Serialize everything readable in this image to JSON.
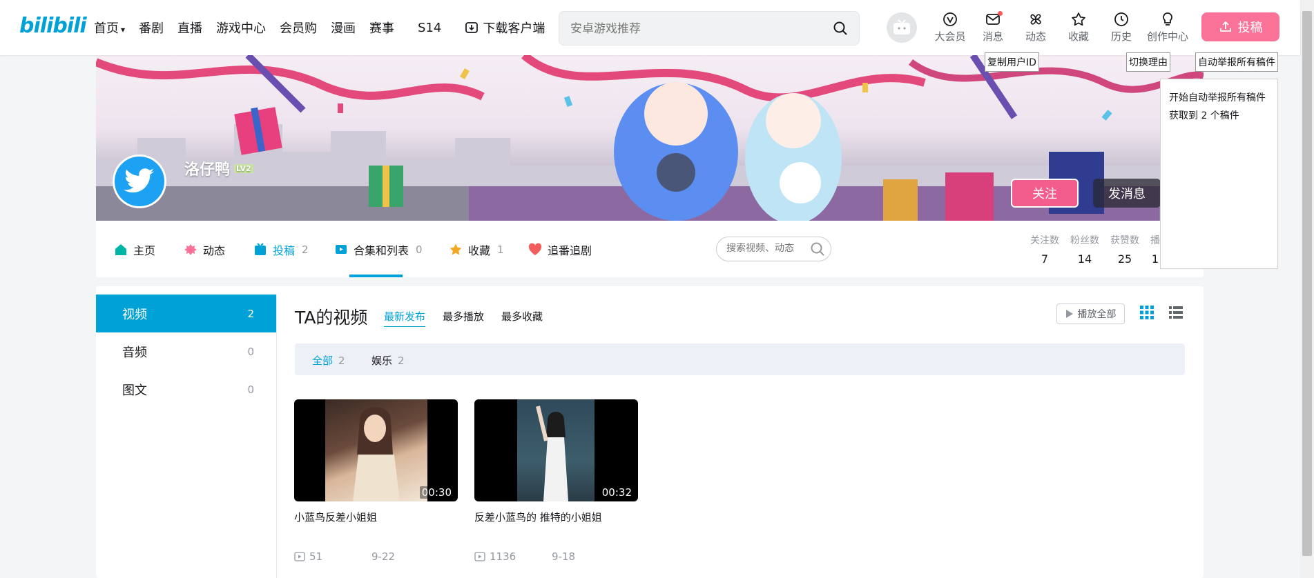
{
  "header": {
    "logo": "bilibili",
    "nav": [
      {
        "label": "首页",
        "has_chevron": true
      },
      {
        "label": "番剧"
      },
      {
        "label": "直播"
      },
      {
        "label": "游戏中心"
      },
      {
        "label": "会员购"
      },
      {
        "label": "漫画"
      },
      {
        "label": "赛事"
      },
      {
        "label": "S14"
      },
      {
        "label": "下载客户端",
        "icon": "download-icon"
      }
    ],
    "search_placeholder": "安卓游戏推荐",
    "tools": [
      {
        "label": "大会员",
        "icon": "vip-icon"
      },
      {
        "label": "消息",
        "icon": "mail-icon",
        "badge": true
      },
      {
        "label": "动态",
        "icon": "pinwheel-icon"
      },
      {
        "label": "收藏",
        "icon": "star-icon"
      },
      {
        "label": "历史",
        "icon": "clock-icon"
      },
      {
        "label": "创作中心",
        "icon": "bulb-icon"
      }
    ],
    "upload_label": "投稿"
  },
  "overlay": {
    "copy_id": "复制用户ID",
    "switch_reason": "切换理由",
    "auto_report": "自动举报所有稿件",
    "panel_line1": "开始自动举报所有稿件",
    "panel_line2": "获取到 2 个稿件"
  },
  "profile": {
    "name": "洛仔鸭",
    "level": "LV2",
    "follow_label": "关注",
    "message_label": "发消息"
  },
  "tabs": [
    {
      "label": "主页",
      "count": "",
      "icon": "home-icon",
      "color": "#00b5a6"
    },
    {
      "label": "动态",
      "count": "",
      "icon": "dynamic-icon",
      "color": "#fb7299"
    },
    {
      "label": "投稿",
      "count": "2",
      "icon": "upload-tab-icon",
      "color": "#00a1d6"
    },
    {
      "label": "合集和列表",
      "count": "0",
      "icon": "collection-icon",
      "color": "#00a1d6"
    },
    {
      "label": "收藏",
      "count": "1",
      "icon": "star-tab-icon",
      "color": "#f5a623"
    },
    {
      "label": "追番追剧",
      "count": "",
      "icon": "heart-icon",
      "color": "#f25d5d"
    }
  ],
  "tab_search_placeholder": "搜索视频、动态",
  "stats": [
    {
      "label": "关注数",
      "value": "7"
    },
    {
      "label": "粉丝数",
      "value": "14"
    },
    {
      "label": "获赞数",
      "value": "25"
    },
    {
      "label": "播",
      "value": "1"
    }
  ],
  "side": [
    {
      "label": "视频",
      "count": "2"
    },
    {
      "label": "音频",
      "count": "0"
    },
    {
      "label": "图文",
      "count": "0"
    }
  ],
  "main": {
    "title": "TA的视频",
    "sorts": [
      "最新发布",
      "最多播放",
      "最多收藏"
    ],
    "play_all": "播放全部",
    "filters": [
      {
        "label": "全部",
        "count": "2"
      },
      {
        "label": "娱乐",
        "count": "2"
      }
    ]
  },
  "videos": [
    {
      "title": "小蓝鸟反差小姐姐",
      "duration": "00:30",
      "plays": "51",
      "date": "9-22"
    },
    {
      "title": "反差小蓝鸟的 推特的小姐姐",
      "duration": "00:32",
      "plays": "1136",
      "date": "9-18"
    }
  ],
  "colors": {
    "brand_blue": "#00a1d6",
    "brand_pink": "#fb7299"
  }
}
